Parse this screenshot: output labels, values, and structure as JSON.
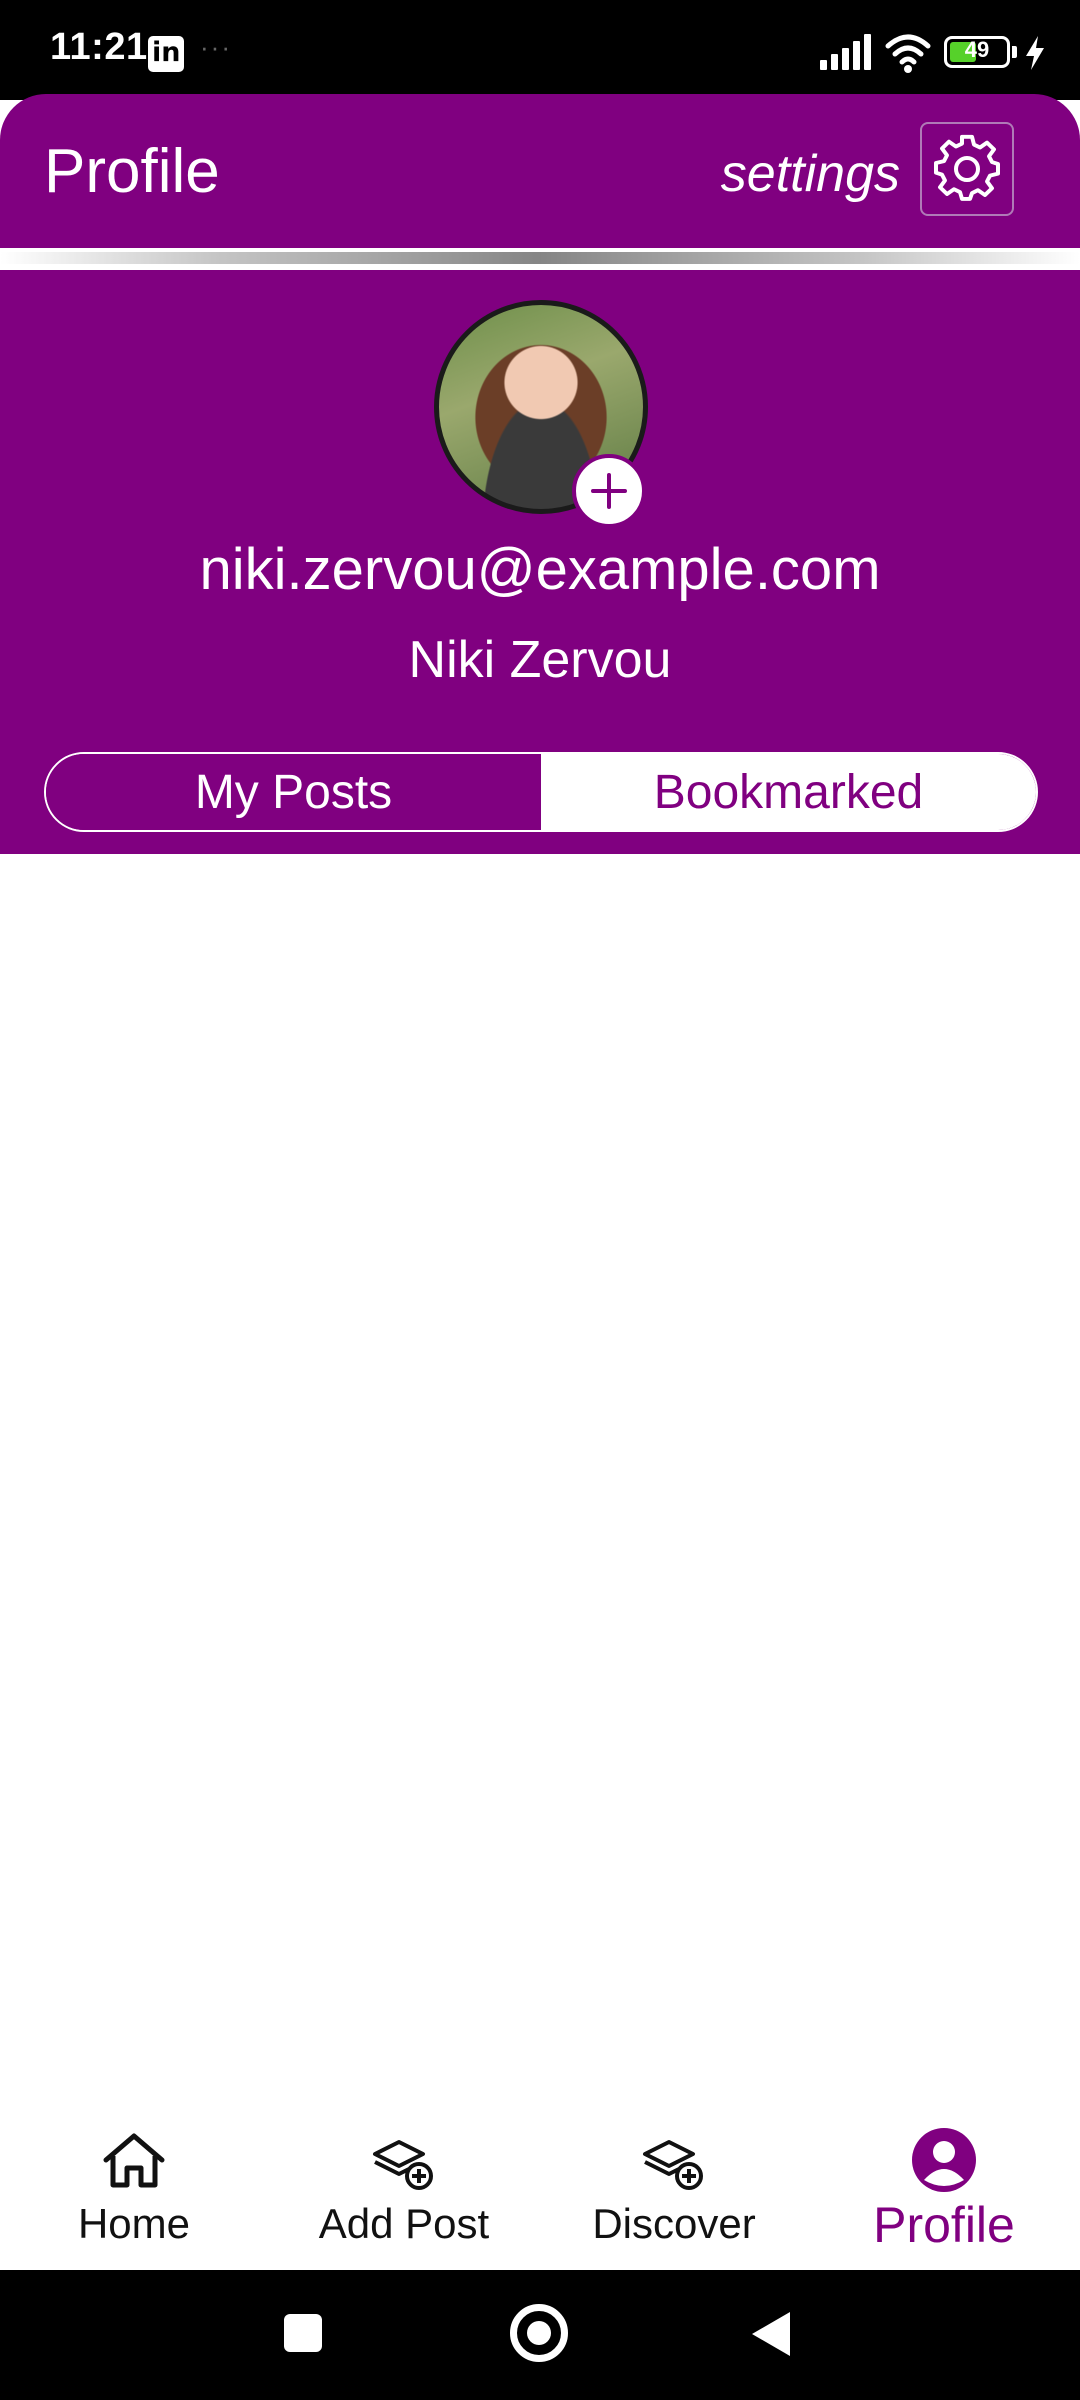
{
  "status_bar": {
    "time": "11:21",
    "app_icon": "linkedin-icon",
    "app_icon_text": "in",
    "dots": "···",
    "battery_level": "49",
    "battery_fraction": 0.49
  },
  "header": {
    "title": "Profile",
    "settings_label": "settings",
    "settings_icon": "gear-icon"
  },
  "profile": {
    "email": "niki.zervou@example.com",
    "name": "Niki Zervou",
    "avatar_icon": "avatar-photo",
    "add_photo_icon": "plus-icon"
  },
  "tabs": {
    "items": [
      {
        "label": "My Posts",
        "active": false
      },
      {
        "label": "Bookmarked",
        "active": true
      }
    ]
  },
  "bottom_nav": {
    "items": [
      {
        "label": "Home",
        "icon": "home-icon",
        "active": false
      },
      {
        "label": "Add Post",
        "icon": "add-post-icon",
        "active": false
      },
      {
        "label": "Discover",
        "icon": "discover-icon",
        "active": false
      },
      {
        "label": "Profile",
        "icon": "profile-icon",
        "active": true
      }
    ]
  },
  "colors": {
    "brand": "#800080",
    "background": "#ffffff",
    "status_bar": "#000000",
    "battery_fill": "#56d12a"
  }
}
